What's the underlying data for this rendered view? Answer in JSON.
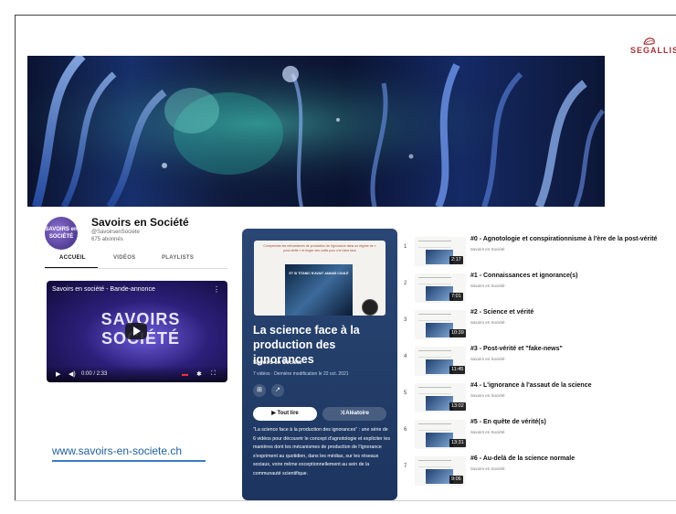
{
  "logo": {
    "text": "SEGALLIS"
  },
  "channel": {
    "avatar_text": "SAVOIRS en SOCIÉTÉ",
    "name": "Savoirs en Société",
    "handle": "@SavoirsenSociete",
    "subscribers": "675 abonnés",
    "tabs": [
      "ACCUEIL",
      "VIDÉOS",
      "PLAYLISTS"
    ]
  },
  "player": {
    "title": "Savoirs en société - Bande-annonce",
    "logo_line1": "SAVOIRS",
    "logo_line2": "SOCIÉTÉ",
    "time": "0:00 / 2:33",
    "progress": 0
  },
  "site_link": "www.savoirs-en-societe.ch",
  "playlist": {
    "thumb_caption": "Comprendre les mécanismes de production de l'ignorance dans un régime de « post-vérité » et forger des outils pour s'en faire face",
    "thumb_image_caption": "ET SI TITANIC N'AVAIT JAMAIS COULÉ",
    "title": "La science face à la production des ignorances",
    "channel": "Savoirs en Société",
    "meta": "7 vidéos · Dernière modification le 22 oct. 2021",
    "play_label": "Tout lire",
    "shuffle_label": "Aléatoire",
    "description": "\"La science face à la production des ignorances\" : une série de 6 vidéos pour découvrir le concept d'agnotologie et expliciter les manières dont les mécanismes de production de l'ignorance s'expriment au quotidien, dans les médias, sur les réseaux sociaux, voire même exceptionnellement au sein de la communauté scientifique."
  },
  "videos": [
    {
      "num": "1",
      "title": "#0 - Agnotologie et conspirationnisme à l'ère de la post-vérité",
      "channel": "Savoirs en Société",
      "duration": "2:17"
    },
    {
      "num": "2",
      "title": "#1 - Connaissances et ignorance(s)",
      "channel": "Savoirs en Société",
      "duration": "7:01"
    },
    {
      "num": "3",
      "title": "#2 - Science et vérité",
      "channel": "Savoirs en Société",
      "duration": "10:39"
    },
    {
      "num": "4",
      "title": "#3 - Post-vérité et \"fake-news\"",
      "channel": "Savoirs en Société",
      "duration": "11:45"
    },
    {
      "num": "5",
      "title": "#4 - L'ignorance à l'assaut de la science",
      "channel": "Savoirs en Société",
      "duration": "13:02"
    },
    {
      "num": "6",
      "title": "#5 - En quête de vérité(s)",
      "channel": "Savoirs en Société",
      "duration": "13:31"
    },
    {
      "num": "7",
      "title": "#6 - Au-delà de la science normale",
      "channel": "Savoirs en Société",
      "duration": "9:06"
    }
  ]
}
